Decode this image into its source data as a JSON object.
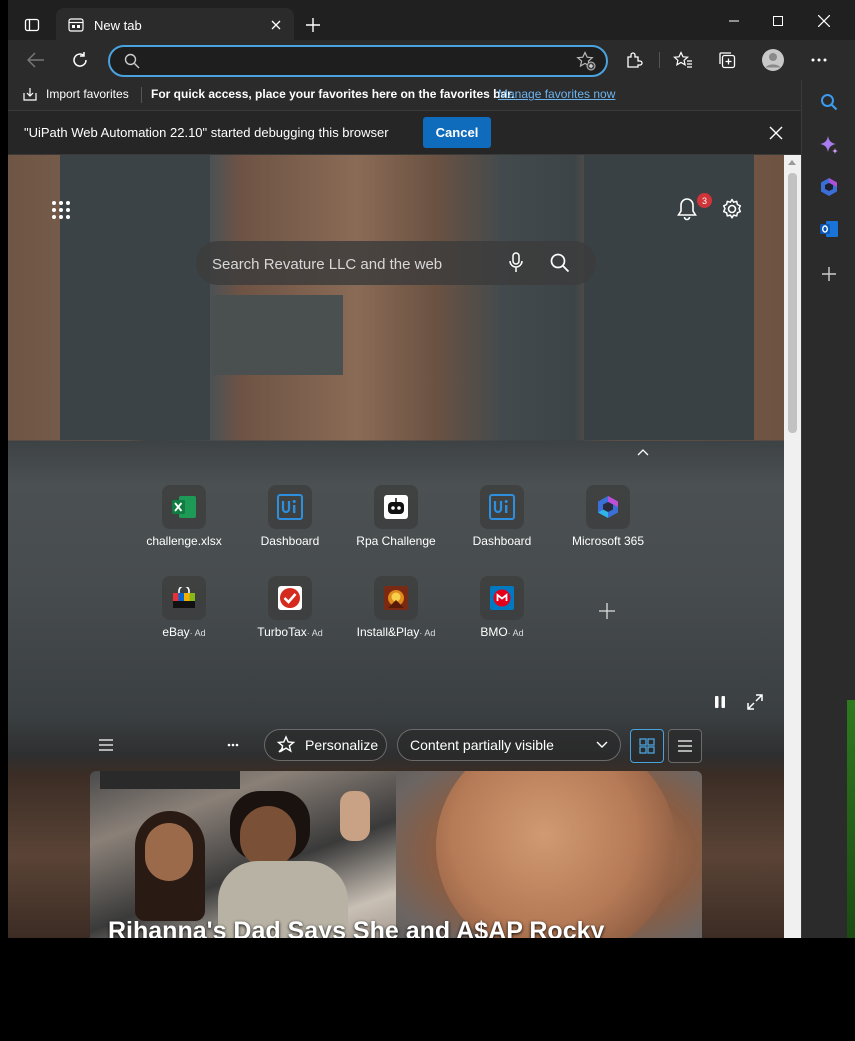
{
  "browser": {
    "tab_title": "New tab",
    "address_value": "",
    "address_placeholder": ""
  },
  "favorites_bar": {
    "import_label": "Import favorites",
    "message": "For quick access, place your favorites here on the favorites bar.",
    "manage_link": "Manage favorites now"
  },
  "infobar": {
    "message": "\"UiPath Web Automation 22.10\" started debugging this browser",
    "cancel_label": "Cancel"
  },
  "newtab": {
    "search_placeholder": "Search Revature LLC and the web",
    "notifications_count": "3",
    "quick_links": [
      {
        "label": "challenge.xlsx",
        "icon": "excel-icon",
        "ad": ""
      },
      {
        "label": "Dashboard",
        "icon": "uipath-icon",
        "ad": ""
      },
      {
        "label": "Rpa Challenge",
        "icon": "robot-icon",
        "ad": ""
      },
      {
        "label": "Dashboard",
        "icon": "uipath-icon",
        "ad": ""
      },
      {
        "label": "Microsoft 365",
        "icon": "m365-icon",
        "ad": ""
      },
      {
        "label": "eBay",
        "icon": "ebay-icon",
        "ad": "· Ad"
      },
      {
        "label": "TurboTax",
        "icon": "turbotax-icon",
        "ad": "· Ad"
      },
      {
        "label": "Install&Play",
        "icon": "game-icon",
        "ad": "· Ad"
      },
      {
        "label": "BMO",
        "icon": "bmo-icon",
        "ad": "· Ad"
      }
    ],
    "personalize_label": "Personalize",
    "content_visibility": "Content partially visible",
    "headline": "Rihanna's Dad Says She and A$AP Rocky"
  },
  "colors": {
    "accent": "#4aa3df",
    "cancel_button": "#0f6cbd",
    "badge": "#d13438"
  }
}
